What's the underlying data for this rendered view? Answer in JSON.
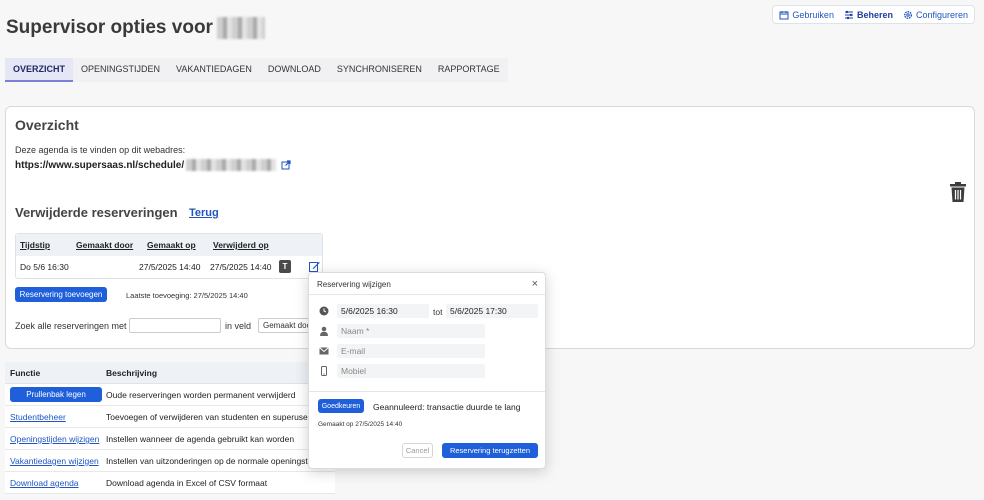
{
  "header": {
    "title": "Supervisor opties voor"
  },
  "topnav": {
    "items": [
      {
        "label": "Gebruiken",
        "icon": "calendar-icon"
      },
      {
        "label": "Beheren",
        "icon": "sliders-icon"
      },
      {
        "label": "Configureren",
        "icon": "gear-icon"
      }
    ]
  },
  "tabs": [
    "OVERZICHT",
    "OPENINGSTIJDEN",
    "VAKANTIEDAGEN",
    "DOWNLOAD",
    "SYNCHRONISEREN",
    "RAPPORTAGE"
  ],
  "overview": {
    "title": "Overzicht",
    "intro": "Deze agenda is te vinden op dit webadres:",
    "url_prefix": "https://www.supersaas.nl/schedule/"
  },
  "deleted": {
    "title": "Verwijderde reserveringen",
    "back_link": "Terug",
    "columns": [
      "Tijdstip",
      "Gemaakt door",
      "Gemaakt op",
      "Verwijderd op"
    ],
    "rows": [
      {
        "tijdstip": "Do 5/6 16:30",
        "gemaakt_door": "",
        "gemaakt_op": "27/5/2025 14:40",
        "verwijderd_op": "27/5/2025 14:40",
        "badge": "T"
      }
    ],
    "add_button": "Reservering toevoegen",
    "last_added": "Laatste toevoeging: 27/5/2025 14:40",
    "search_label": "Zoek alle reserveringen met",
    "search_value": "",
    "in_field_label": "in veld",
    "field_select": "Gemaakt door"
  },
  "functions": {
    "columns": [
      "Functie",
      "Beschrijving"
    ],
    "rows": [
      {
        "name": "Prullenbak legen",
        "desc": "Oude reserveringen worden permanent verwijderd",
        "button": true
      },
      {
        "name": "Studentbeheer",
        "desc": "Toevoegen of verwijderen van studenten en superusers",
        "button": false
      },
      {
        "name": "Openingstijden wijzigen",
        "desc": "Instellen wanneer de agenda gebruikt kan worden",
        "button": false
      },
      {
        "name": "Vakantiedagen wijzigen",
        "desc": "Instellen van uitzonderingen op de normale openingstijden",
        "button": false
      },
      {
        "name": "Download agenda",
        "desc": "Download agenda in Excel of CSV formaat",
        "button": false
      }
    ]
  },
  "modal": {
    "title": "Reservering wijzigen",
    "close": "×",
    "start_value": "5/6/2025  16:30",
    "to_label": "tot",
    "end_value": "5/6/2025  17:30",
    "name_placeholder": "Naam *",
    "email_placeholder": "E-mail",
    "mobile_placeholder": "Mobiel",
    "approve_button": "Goedkeuren",
    "status": "Geannuleerd: transactie duurde te lang",
    "created": "Gemaakt op 27/5/2025 14:40",
    "cancel_button": "Cancel",
    "restore_button": "Reservering terugzetten"
  },
  "colors": {
    "accent": "#1f5fd9",
    "link": "#1f56c2",
    "active_tab_bg": "#e6e7f6"
  }
}
